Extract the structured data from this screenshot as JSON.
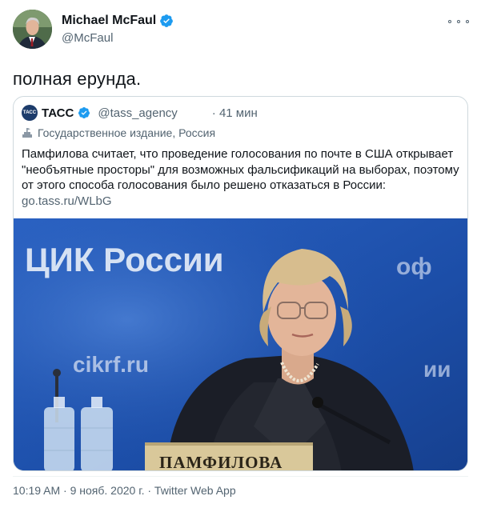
{
  "author": {
    "name": "Michael McFaul",
    "handle": "@McFaul"
  },
  "tweet_text": "полная ерунда.",
  "quote": {
    "logo_text": "ТАСС",
    "name": "ТАСС",
    "handle": "@tass_agency",
    "time": "· 41 мин",
    "label": "Государственное издание, Россия",
    "text": "Памфилова считает, что проведение голосования по почте в США открывает \"необъятные просторы\" для возможных фальсификаций на выборах, поэтому от этого способа голосования было решено отказаться в России:",
    "link": "go.tass.ru/WLbG",
    "image": {
      "sign_main": "ЦИК России",
      "sign_site": "cikrf.ru",
      "sign_right": "оф",
      "sign_right2": "ии",
      "nameplate": "ПАМФИЛОВА"
    }
  },
  "footer": "10:19 AM · 9 нояб. 2020 г. · Twitter Web App",
  "colors": {
    "verified": "#1d9bf0",
    "secondary_text": "#536471",
    "border": "#cfd9de"
  }
}
